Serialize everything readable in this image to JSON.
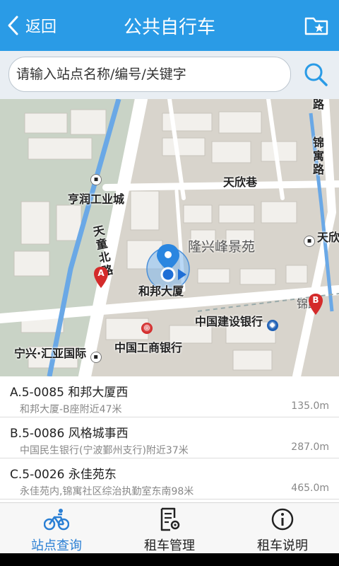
{
  "header": {
    "back_label": "返回",
    "title": "公共自行车"
  },
  "search": {
    "placeholder": "请输入站点名称/编号/关键字"
  },
  "map": {
    "labels": {
      "hengrun": "亨润工业城",
      "tianxin_alley": "天欣巷",
      "tiantong_north": "天童北路",
      "longxing": "隆兴峰景苑",
      "hebang": "和邦大厦",
      "ccb": "中国建设银行",
      "icbc": "中国工商银行",
      "ningxing": "宁兴·汇亚国际",
      "jinyu_top": "锦寓路",
      "jinyu_right": "锦路",
      "tianxin_right": "天欣",
      "lu_corner": "路"
    },
    "markers": {
      "a": "A",
      "b": "B"
    }
  },
  "stations": [
    {
      "title": "A.5-0085 和邦大厦西",
      "address": "和邦大厦-B座附近47米",
      "distance": "135.0m"
    },
    {
      "title": "B.5-0086 风格城事西",
      "address": "中国民生银行(宁波鄞州支行)附近37米",
      "distance": "287.0m"
    },
    {
      "title": "C.5-0026 永佳苑东",
      "address": "永佳苑内,锦寓社区综治执勤室东南98米",
      "distance": "465.0m"
    }
  ],
  "tabs": [
    {
      "label": "站点查询",
      "icon": "bicycle-icon",
      "active": true
    },
    {
      "label": "租车管理",
      "icon": "document-gear-icon",
      "active": false
    },
    {
      "label": "租车说明",
      "icon": "info-icon",
      "active": false
    }
  ],
  "colors": {
    "header": "#2a9be6",
    "accent": "#2a7fd4",
    "marker": "#d42b2b"
  }
}
